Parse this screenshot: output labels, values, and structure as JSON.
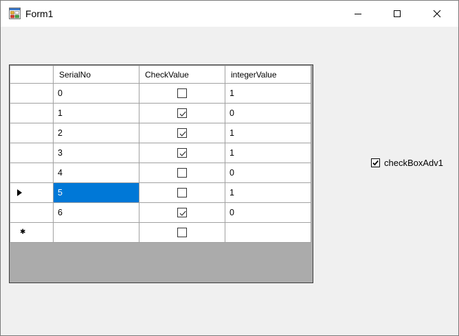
{
  "window": {
    "title": "Form1",
    "icons": {
      "app": "winforms-app-icon",
      "minimize": "minimize-icon",
      "maximize": "maximize-icon",
      "close": "close-icon"
    }
  },
  "grid": {
    "columns": [
      "SerialNo",
      "CheckValue",
      "integerValue"
    ],
    "rows": [
      {
        "serial": "0",
        "check": false,
        "integer": "1"
      },
      {
        "serial": "1",
        "check": true,
        "integer": "0"
      },
      {
        "serial": "2",
        "check": true,
        "integer": "1"
      },
      {
        "serial": "3",
        "check": true,
        "integer": "1"
      },
      {
        "serial": "4",
        "check": false,
        "integer": "0"
      },
      {
        "serial": "5",
        "check": false,
        "integer": "1",
        "current": true
      },
      {
        "serial": "6",
        "check": true,
        "integer": "0"
      }
    ],
    "new_row": {
      "serial": "",
      "check": false,
      "integer": ""
    },
    "current_row_marker": "▶",
    "new_row_marker": "✱",
    "colors": {
      "selection": "#0078d7",
      "empty_area": "#ababab",
      "gridline": "#a0a0a0"
    }
  },
  "checkbox_adv": {
    "label": "checkBoxAdv1",
    "checked": true
  }
}
